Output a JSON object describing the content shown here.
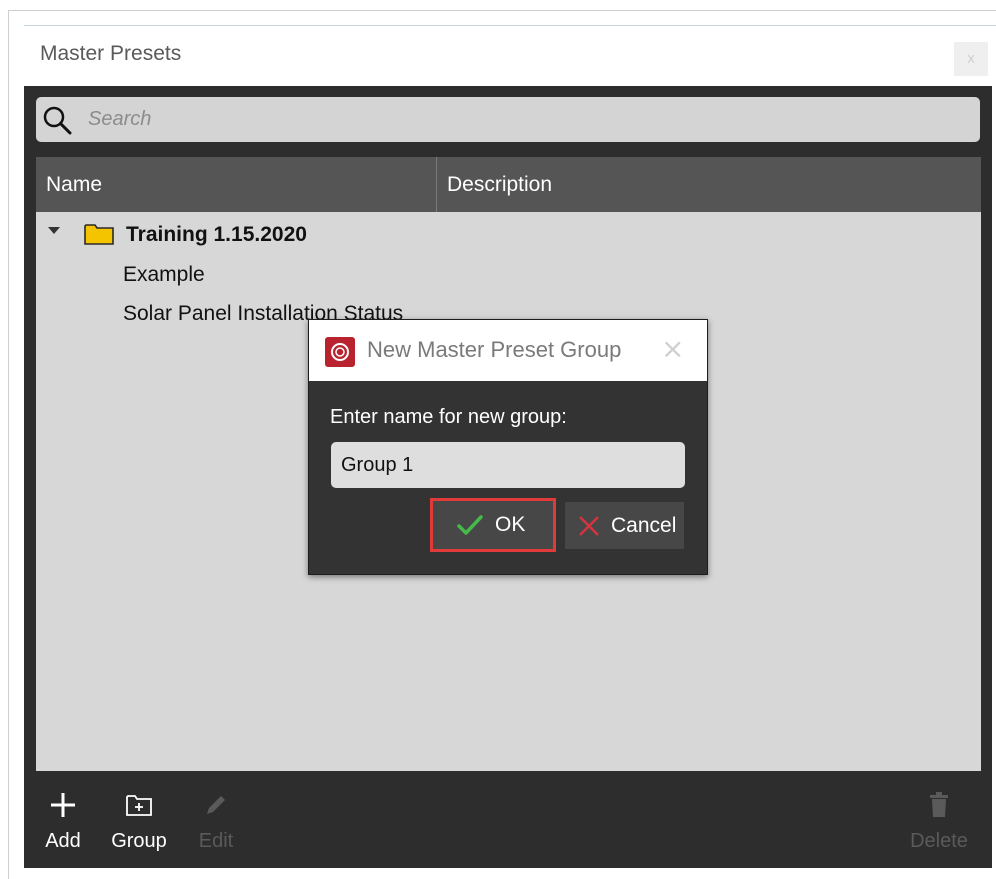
{
  "window": {
    "title": "Master Presets",
    "close_glyph": "x"
  },
  "search": {
    "placeholder": "Search",
    "icon": "search-icon"
  },
  "table": {
    "columns": [
      "Name",
      "Description"
    ],
    "group": {
      "label": "Training 1.15.2020",
      "expanded": true,
      "icon": "folder-icon",
      "folder_color": "#f5c400"
    },
    "items": [
      "Example",
      "Solar Panel Installation Status"
    ]
  },
  "footer": {
    "add": {
      "label": "Add",
      "icon": "plus-icon",
      "enabled": true
    },
    "group": {
      "label": "Group",
      "icon": "folder-add-icon",
      "enabled": true
    },
    "edit": {
      "label": "Edit",
      "icon": "pencil-icon",
      "enabled": false
    },
    "delete": {
      "label": "Delete",
      "icon": "trash-icon",
      "enabled": false
    }
  },
  "dialog": {
    "title": "New Master Preset Group",
    "close_glyph": "×",
    "prompt": "Enter name for new group:",
    "input_value": "Group 1",
    "ok_label": "OK",
    "cancel_label": "Cancel",
    "app_icon_color": "#b8232f",
    "highlight_color": "#e03a3a"
  }
}
